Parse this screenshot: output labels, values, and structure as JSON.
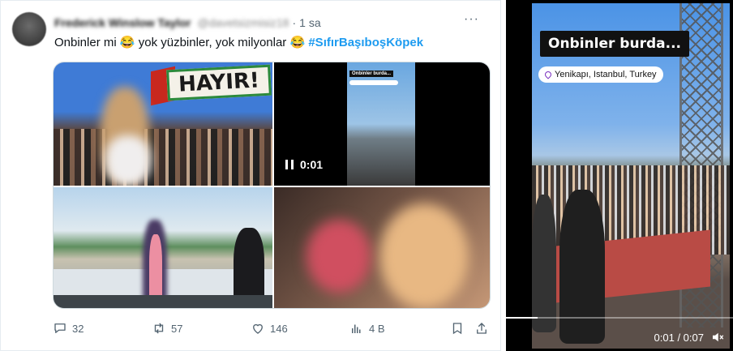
{
  "tweet": {
    "author_name": "Frederick Winslow Taylor",
    "author_handle": "@davetsizmisiz18",
    "separator": "·",
    "time": "1 sa",
    "more_label": "···",
    "text_part1": "Onbinler mi",
    "emoji1": "😂",
    "text_part2": "yok yüzbinler, yok milyonlar",
    "emoji2": "😂",
    "hashtag": "#SıfırBaşıboşKöpek",
    "media": {
      "sign_text": "HAYIR!",
      "video_thumb_title": "Onbinler burda...",
      "video_time": "0:01"
    },
    "actions": {
      "replies": "32",
      "retweets": "57",
      "likes": "146",
      "views": "4 B"
    }
  },
  "video_panel": {
    "title": "Onbinler burda...",
    "location": "Yenikapı, Istanbul, Turkey",
    "time_display": "0:01 / 0:07",
    "progress": 0.14
  },
  "icons": {
    "reply": "reply-icon",
    "retweet": "retweet-icon",
    "like": "heart-icon",
    "views": "views-icon",
    "bookmark": "bookmark-icon",
    "share": "share-icon",
    "volume": "volume-icon",
    "pause": "pause-icon",
    "location": "location-pin-icon"
  },
  "colors": {
    "hashtag": "#1d9bf0",
    "muted": "#536471"
  }
}
